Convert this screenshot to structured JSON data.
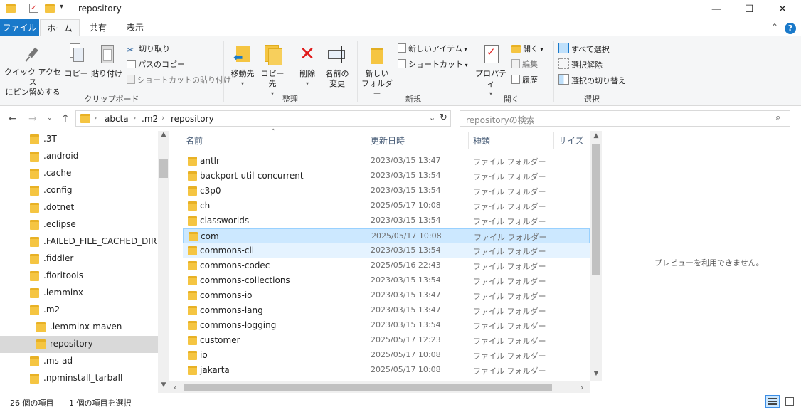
{
  "window": {
    "title": "repository",
    "minimize_icon": "—",
    "maximize_icon": "☐",
    "close_icon": "✕"
  },
  "tabs": {
    "file": "ファイル",
    "home": "ホーム",
    "share": "共有",
    "view": "表示"
  },
  "ribbon": {
    "clipboard": {
      "pin": "クイック アクセス\nにピン留めする",
      "copy": "コピー",
      "paste": "貼り付け",
      "cut": "切り取り",
      "copy_path": "パスのコピー",
      "paste_shortcut": "ショートカットの貼り付け",
      "label": "クリップボード"
    },
    "organize": {
      "move_to": "移動先",
      "copy_to": "コピー先",
      "delete": "削除",
      "rename": "名前の\n変更",
      "label": "整理"
    },
    "new": {
      "new_folder": "新しい\nフォルダー",
      "new_item": "新しいアイテム",
      "shortcut": "ショートカット",
      "label": "新規"
    },
    "open": {
      "properties": "プロパティ",
      "open": "開く",
      "edit": "編集",
      "history": "履歴",
      "label": "開く"
    },
    "select": {
      "select_all": "すべて選択",
      "select_none": "選択解除",
      "invert": "選択の切り替え",
      "label": "選択"
    }
  },
  "address": {
    "crumbs": [
      "abcta",
      ".m2",
      "repository"
    ],
    "search_placeholder": "repositoryの検索"
  },
  "nav_tree": [
    {
      "label": ".3T",
      "indent": 0,
      "selected": false
    },
    {
      "label": ".android",
      "indent": 0,
      "selected": false
    },
    {
      "label": ".cache",
      "indent": 0,
      "selected": false
    },
    {
      "label": ".config",
      "indent": 0,
      "selected": false
    },
    {
      "label": ".dotnet",
      "indent": 0,
      "selected": false
    },
    {
      "label": ".eclipse",
      "indent": 0,
      "selected": false
    },
    {
      "label": ".FAILED_FILE_CACHED_DIR",
      "indent": 0,
      "selected": false
    },
    {
      "label": ".fiddler",
      "indent": 0,
      "selected": false
    },
    {
      "label": ".fioritools",
      "indent": 0,
      "selected": false
    },
    {
      "label": ".lemminx",
      "indent": 0,
      "selected": false
    },
    {
      "label": ".m2",
      "indent": 0,
      "selected": false
    },
    {
      "label": ".lemminx-maven",
      "indent": 1,
      "selected": false
    },
    {
      "label": "repository",
      "indent": 1,
      "selected": true
    },
    {
      "label": ".ms-ad",
      "indent": 0,
      "selected": false
    },
    {
      "label": ".npminstall_tarball",
      "indent": 0,
      "selected": false
    }
  ],
  "columns": {
    "name": "名前",
    "date": "更新日時",
    "type": "種類",
    "size": "サイズ"
  },
  "files": [
    {
      "name": "antlr",
      "date": "2023/03/15 13:47",
      "type": "ファイル フォルダー"
    },
    {
      "name": "backport-util-concurrent",
      "date": "2023/03/15 13:54",
      "type": "ファイル フォルダー"
    },
    {
      "name": "c3p0",
      "date": "2023/03/15 13:54",
      "type": "ファイル フォルダー"
    },
    {
      "name": "ch",
      "date": "2025/05/17 10:08",
      "type": "ファイル フォルダー"
    },
    {
      "name": "classworlds",
      "date": "2023/03/15 13:54",
      "type": "ファイル フォルダー"
    },
    {
      "name": "com",
      "date": "2025/05/17 10:08",
      "type": "ファイル フォルダー"
    },
    {
      "name": "commons-cli",
      "date": "2023/03/15 13:54",
      "type": "ファイル フォルダー"
    },
    {
      "name": "commons-codec",
      "date": "2025/05/16 22:43",
      "type": "ファイル フォルダー"
    },
    {
      "name": "commons-collections",
      "date": "2023/03/15 13:54",
      "type": "ファイル フォルダー"
    },
    {
      "name": "commons-io",
      "date": "2023/03/15 13:47",
      "type": "ファイル フォルダー"
    },
    {
      "name": "commons-lang",
      "date": "2023/03/15 13:47",
      "type": "ファイル フォルダー"
    },
    {
      "name": "commons-logging",
      "date": "2023/03/15 13:54",
      "type": "ファイル フォルダー"
    },
    {
      "name": "customer",
      "date": "2025/05/17 12:23",
      "type": "ファイル フォルダー"
    },
    {
      "name": "io",
      "date": "2025/05/17 10:08",
      "type": "ファイル フォルダー"
    },
    {
      "name": "jakarta",
      "date": "2025/05/17 10:08",
      "type": "ファイル フォルダー"
    }
  ],
  "preview": {
    "message": "プレビューを利用できません。"
  },
  "status": {
    "item_count": "26 個の項目",
    "selected": "1 個の項目を選択"
  },
  "colors": {
    "file_tab": "#1979ca",
    "selection": "#cce8ff",
    "folder": "#f5c542"
  }
}
